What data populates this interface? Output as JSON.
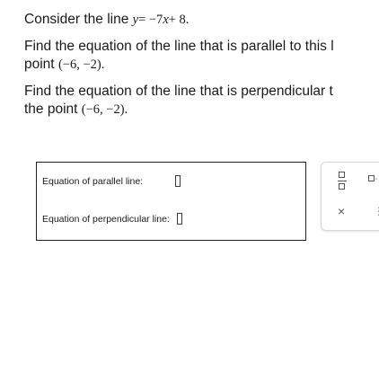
{
  "question": {
    "line1_prefix": "Consider the line",
    "line1_equation_y": "y",
    "line1_equation_rest": "= −7",
    "line1_equation_x": "x",
    "line1_equation_tail": "+ 8.",
    "parallel_prompt_line1": "Find the equation of the line that is parallel to this l",
    "parallel_prompt_line2": "point",
    "parallel_point": "(−6,  −2).",
    "perp_prompt_line1": "Find the equation of the line that is perpendicular t",
    "perp_prompt_line2": "the point",
    "perp_point": "(−6,  −2)."
  },
  "answer_box": {
    "parallel_label": "Equation of parallel line:",
    "perpendicular_label": "Equation of perpendicular line:",
    "parallel_value": "",
    "perpendicular_value": ""
  },
  "tool_panel": {
    "fraction_icon": "fraction-icon",
    "mixed_number_icon": "mixed-number-icon",
    "close_symbol": "×",
    "more_symbol": "⋮"
  }
}
